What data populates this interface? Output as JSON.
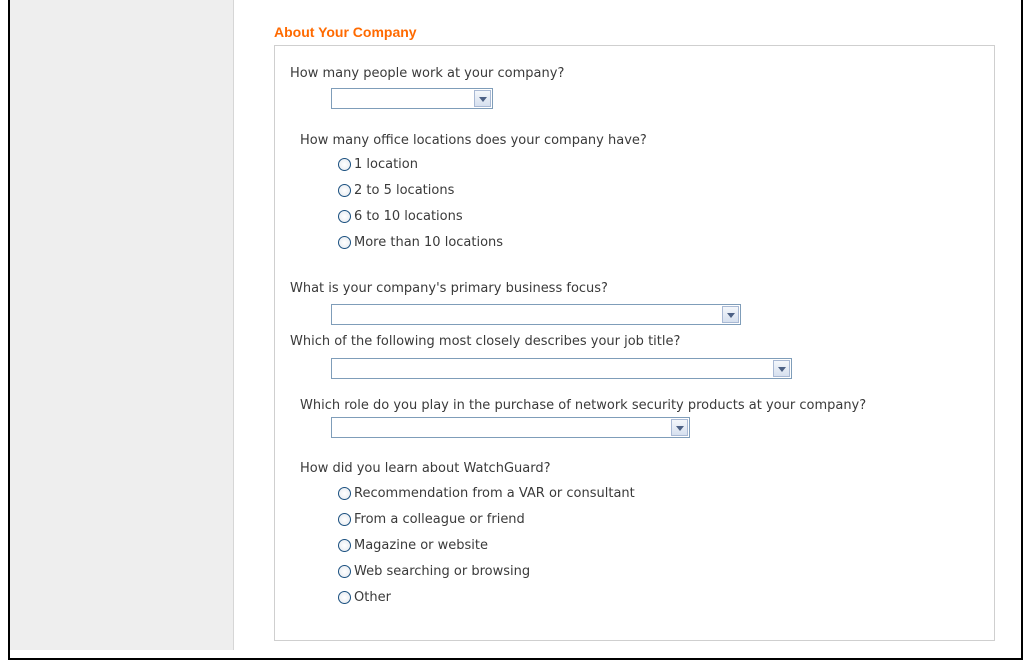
{
  "section": {
    "title": "About Your Company"
  },
  "questions": {
    "employees": {
      "label": "How many people work at your company?",
      "value": ""
    },
    "locations": {
      "label": "How many office locations does your company have?",
      "options": [
        "1 location",
        "2 to 5 locations",
        "6 to 10 locations",
        "More than 10 locations"
      ]
    },
    "business_focus": {
      "label": "What is your company's primary business focus?",
      "value": ""
    },
    "job_title": {
      "label": "Which of the following most closely describes your job title?",
      "value": ""
    },
    "purchase_role": {
      "label": "Which role do you play in the purchase of network security products at your company?",
      "value": ""
    },
    "learned": {
      "label": "How did you learn about WatchGuard?",
      "options": [
        "Recommendation from a VAR or consultant",
        "From a colleague or friend",
        "Magazine or website",
        "Web searching or browsing",
        "Other"
      ]
    }
  },
  "colors": {
    "title": "#ff6a00",
    "text": "#3a3a3a",
    "sidebar": "#eeeeee",
    "select_border": "#7f9db9"
  },
  "icons": {
    "dropdown": "chevron-down-icon",
    "radio": "radio-button-icon"
  }
}
